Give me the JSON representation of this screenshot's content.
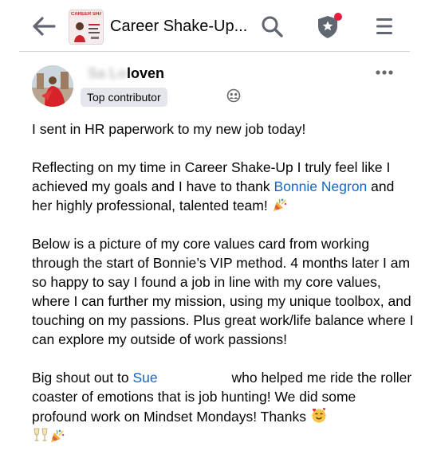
{
  "header": {
    "group_thumb_text": "CAREER SHAKE-UP CL",
    "group_name": "Career Shake-Up..."
  },
  "post": {
    "author_name_visible": "loven",
    "author_badge": "Top contributor",
    "p1": "I sent in HR paperwork to my new job today!",
    "p2_a": "Reflecting on my time in Career Shake-Up I truly feel like I achieved my goals and I have to thank ",
    "p2_link": "Bonnie Negron",
    "p2_b": " and her highly professional, talented team! ",
    "p3": "Below is a picture of my core values card from working through the start of Bonnie’s VIP method. 4 months later I am so happy to say I found a job in line with my core values, where I can further my mission, using my unique toolbox, and touching on my passions. Plus great work/life balance where I can explore my outside of work passions!",
    "p4_a": "Big shout out to ",
    "p4_link": "Sue",
    "p4_b": " who helped me ride the roller coaster of emotions that is job hunting! We did some profound work on Mindset Mondays! Thanks "
  },
  "colors": {
    "link": "#1565c0",
    "notification_dot": "#e41e3f",
    "icon": "#606770",
    "badge_bg": "#e4e6eb"
  },
  "icons": [
    "back-arrow-icon",
    "search-icon",
    "admin-shield-star-icon",
    "menu-icon",
    "more-options-icon",
    "audience-group-icon",
    "party-popper-emoji",
    "smiling-face-hearts-emoji",
    "champagne-glasses-emoji"
  ]
}
